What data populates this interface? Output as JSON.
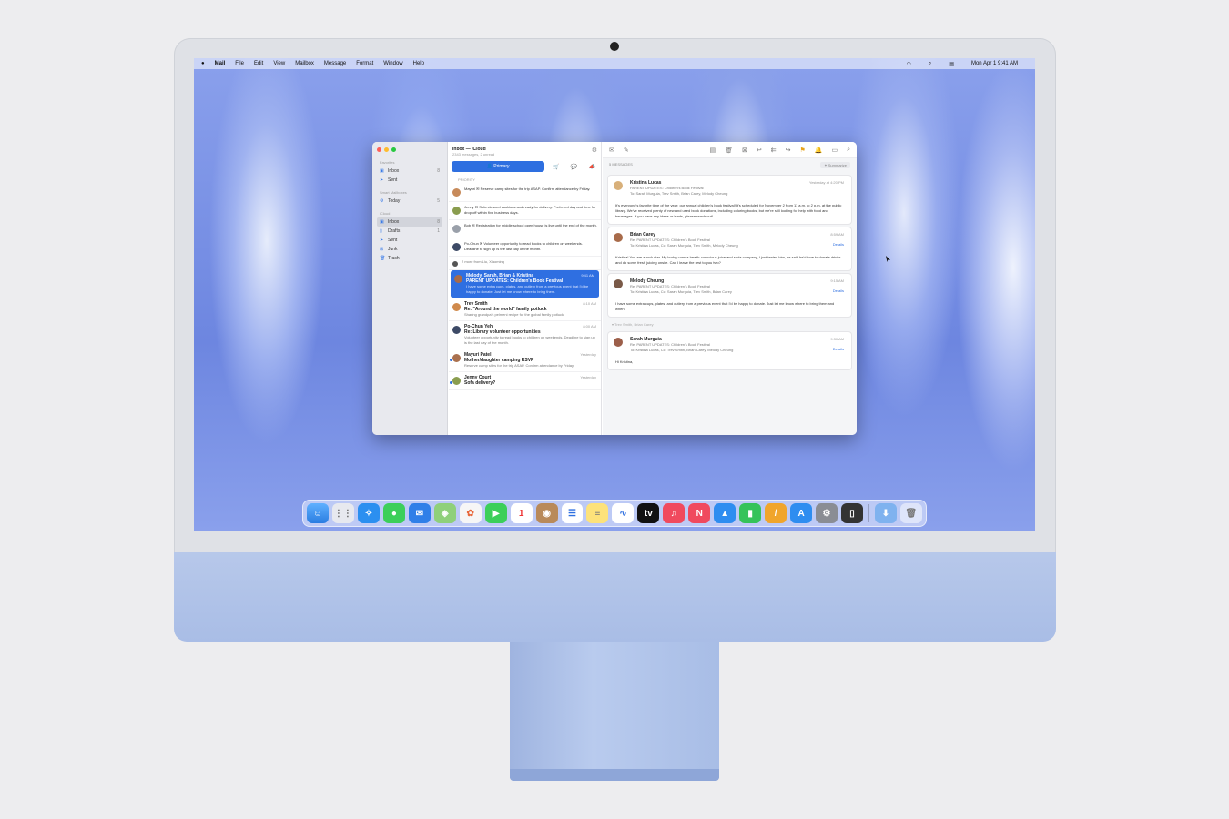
{
  "menubar": {
    "apple": "",
    "items": [
      "Mail",
      "File",
      "Edit",
      "View",
      "Mailbox",
      "Message",
      "Format",
      "Window",
      "Help"
    ],
    "clock": "Mon Apr 1  9:41 AM"
  },
  "sidebar": {
    "favorites_label": "Favorites",
    "favorites": [
      {
        "label": "Inbox",
        "count": "8"
      },
      {
        "label": "Sent",
        "count": ""
      }
    ],
    "smart_label": "Smart Mailboxes",
    "smart": [
      {
        "label": "Today",
        "count": "5"
      }
    ],
    "icloud_label": "iCloud",
    "icloud": [
      {
        "label": "Inbox",
        "count": "8"
      },
      {
        "label": "Drafts",
        "count": "1"
      },
      {
        "label": "Sent",
        "count": ""
      },
      {
        "label": "Junk",
        "count": ""
      },
      {
        "label": "Trash",
        "count": ""
      }
    ]
  },
  "list": {
    "title": "Inbox — iCloud",
    "subtitle": "2343 messages, 2 unread",
    "primary_tab": "Primary",
    "priority_label": "PRIORITY",
    "priority": [
      {
        "text": "Mayuri ✉ Reserve camp sites for the trip ASAP. Confirm attendance by Friday."
      },
      {
        "text": "Jenny ✉ Sofa cleaned cushions and ready for delivery. Preferred day and time for drop off within five business days."
      },
      {
        "text": "Bob ✉ Registration for middle school open house is live until the end of the month."
      },
      {
        "text": "Po-Chun ✉ Volunteer opportunity to read books to children on weekends. Deadline to sign up is the last day of the month."
      }
    ],
    "more": "2 more from Liu, Xiaoming",
    "selected": {
      "from": "Melody, Sarah, Brian & Kristina",
      "time": "9:41 AM",
      "subject": "PARENT UPDATES: Children's Book Festival",
      "count": "5",
      "preview": "I have some extra cups, plates, and cutlery from a previous event that I'd be happy to donate. Just let me know where to bring them."
    },
    "messages": [
      {
        "from": "Trev Smith",
        "time": "8:10 AM",
        "subject": "Re: \"Around the world\" family potluck",
        "preview": "Sharing grandpa's pelmeni recipe for the global family potluck"
      },
      {
        "from": "Po-Chun Yeh",
        "time": "8:00 AM",
        "subject": "Re: Library volunteer opportunities",
        "preview": "Volunteer opportunity to read books to children on weekends. Deadline to sign up is the last day of the month."
      },
      {
        "from": "Mayuri Patel",
        "time": "Yesterday",
        "subject": "Mother/daughter camping RSVP",
        "preview": "Reserve camp sites for the trip ASAP. Confirm attendance by Friday."
      },
      {
        "from": "Jenny Court",
        "time": "Yesterday",
        "subject": "Sofa delivery?",
        "preview": ""
      }
    ]
  },
  "thread": {
    "count": "5 MESSAGES",
    "summarize": "Summarize",
    "cards": [
      {
        "from": "Kristina Lucas",
        "time": "Yesterday at 4:20 PM",
        "subject": "PARENT UPDATES: Children's Book Festival",
        "to": "To:  Sarah Murguia,  Trev Smith,  Brian Carey,  Melody Cheung",
        "details": "",
        "body": "It's everyone's favorite time of the year: our annual children's book festival! It's scheduled for November 2 from 11 a.m. to 2 p.m. at the public library. We've received plenty of new and used book donations, including coloring books, but we're still looking for help with food and beverages. If you have any ideas or leads, please reach out!"
      },
      {
        "from": "Brian Carey",
        "time": "8:59 AM",
        "subject": "Re: PARENT UPDATES: Children's Book Festival",
        "to": "To:  Kristina Lucas,  Cc:  Sarah Murguia,  Trev Smith,  Melody Cheung",
        "details": "Details",
        "body": "Kristina! You are a rock star. My buddy runs a health-conscious juice and soda company, I just texted him, he said he'd love to donate drinks and do some fresh juicing onsite. Can I leave the rest to you two?"
      },
      {
        "from": "Melody Cheung",
        "time": "9:15 AM",
        "subject": "Re: PARENT UPDATES: Children's Book Festival",
        "to": "To:  Kristina Lucas,  Cc:  Sarah Murguia,  Trev Smith,  Brian Carey",
        "details": "Details",
        "body": "I have some extra cups, plates, and cutlery from a previous event that I'd be happy to donate. Just let me know where to bring them and when."
      }
    ],
    "fold": "Trev Smith, Brian Carey",
    "last": {
      "from": "Sarah Murguia",
      "time": "9:30 AM",
      "subject": "Re: PARENT UPDATES: Children's Book Festival",
      "to": "To:  Kristina Lucas,  Cc:  Trev Smith,  Brian Carey,  Melody Cheung",
      "details": "Details",
      "body": "Hi Kristina,"
    }
  },
  "dock": [
    "finder",
    "launchpad",
    "safari",
    "messages",
    "mail",
    "maps",
    "photos",
    "facetime",
    "calendar",
    "contacts",
    "reminders",
    "notes",
    "freeform",
    "tv",
    "music",
    "news",
    "keynote",
    "numbers",
    "pages",
    "app-store",
    "settings",
    "iphone-mirroring",
    "downloads",
    "trash"
  ],
  "colors": {
    "accent": "#2e6fe0",
    "flag": "#e8a31a"
  }
}
